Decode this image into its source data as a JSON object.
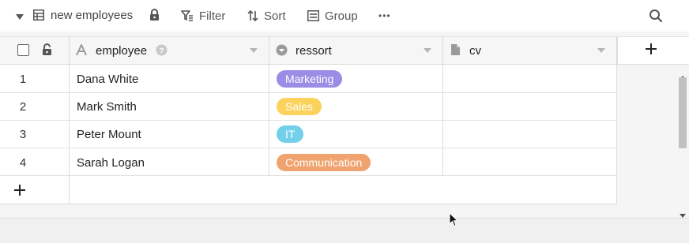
{
  "toolbar": {
    "view_name": "new employees",
    "filter_label": "Filter",
    "sort_label": "Sort",
    "group_label": "Group",
    "more_label": "•••"
  },
  "columns": [
    {
      "name": "employee",
      "icon": "text-icon"
    },
    {
      "name": "ressort",
      "icon": "single-select-icon"
    },
    {
      "name": "cv",
      "icon": "file-icon"
    }
  ],
  "rows": [
    {
      "num": "1",
      "employee": "Dana White",
      "ressort": "Marketing",
      "color": "#9b8ce6"
    },
    {
      "num": "2",
      "employee": "Mark Smith",
      "ressort": "Sales",
      "color": "#fbd35c"
    },
    {
      "num": "3",
      "employee": "Peter Mount",
      "ressort": "IT",
      "color": "#72d0ea"
    },
    {
      "num": "4",
      "employee": "Sarah Logan",
      "ressort": "Communication",
      "color": "#f0a36f"
    }
  ],
  "add_column_label": "+",
  "add_row_label": "+"
}
